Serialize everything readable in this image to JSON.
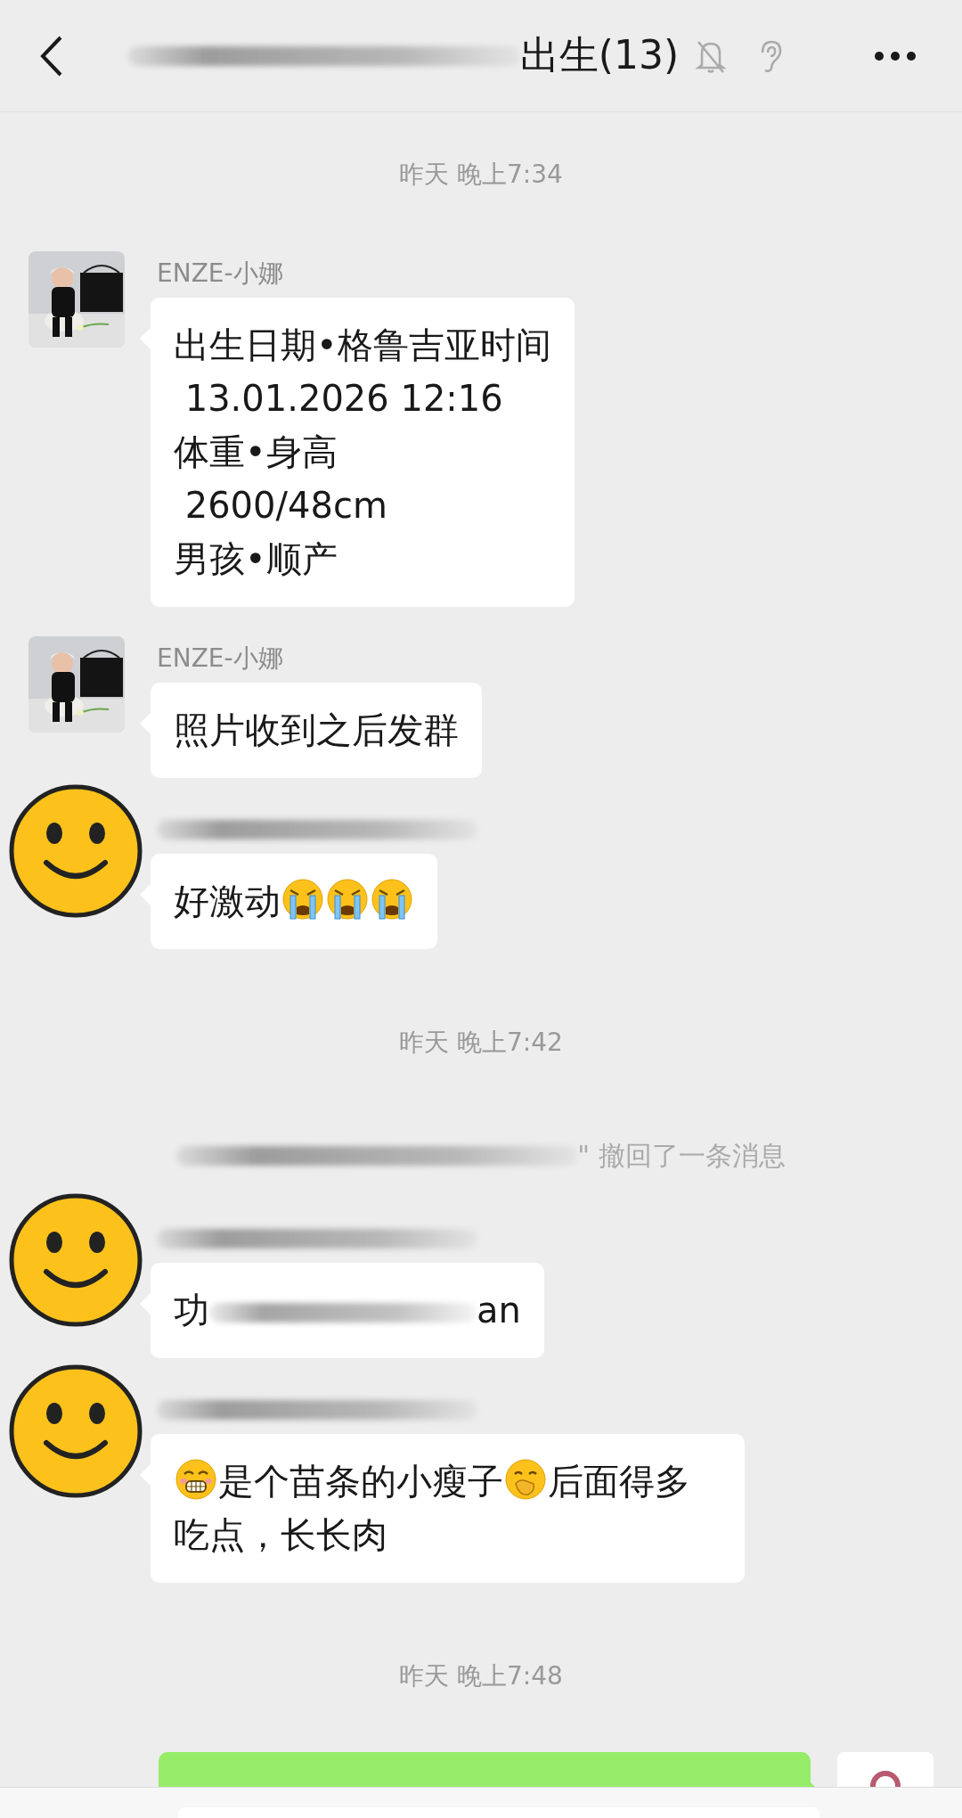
{
  "header": {
    "title_parts": [
      {
        "kind": "redacted"
      },
      {
        "kind": "text",
        "text": "出生(13)"
      }
    ]
  },
  "messages": [
    {
      "kind": "time",
      "text": "昨天 晚上7:34"
    },
    {
      "kind": "incoming",
      "avatar": {
        "kind": "picture"
      },
      "sender": [
        {
          "kind": "text",
          "text": "ENZE-小娜"
        }
      ],
      "content": [
        {
          "kind": "text",
          "text": "出生日期•格鲁吉亚时间\n 13.01.2026 12:16\n体重•身高\n 2600/48cm\n男孩•顺产"
        }
      ]
    },
    {
      "kind": "incoming",
      "avatar": {
        "kind": "picture"
      },
      "sender": [
        {
          "kind": "text",
          "text": "ENZE-小娜"
        }
      ],
      "content": [
        {
          "kind": "text",
          "text": "照片收到之后发群"
        }
      ]
    },
    {
      "kind": "incoming",
      "avatar": {
        "kind": "smiley"
      },
      "sender": [
        {
          "kind": "redacted"
        }
      ],
      "content": [
        {
          "kind": "text",
          "text": "好激动"
        },
        {
          "kind": "crying_emoji"
        },
        {
          "kind": "crying_emoji"
        },
        {
          "kind": "crying_emoji"
        }
      ]
    },
    {
      "kind": "time",
      "text": "昨天 晚上7:42"
    },
    {
      "kind": "recall",
      "parts": [
        {
          "kind": "redacted"
        },
        {
          "kind": "text",
          "text": "\" 撤回了一条消息"
        }
      ]
    },
    {
      "kind": "incoming",
      "avatar": {
        "kind": "smiley"
      },
      "sender": [
        {
          "kind": "redacted"
        }
      ],
      "content": [
        {
          "kind": "text",
          "text": "功"
        },
        {
          "kind": "redacted"
        },
        {
          "kind": "text",
          "text": "an"
        }
      ]
    },
    {
      "kind": "incoming",
      "avatar": {
        "kind": "smiley"
      },
      "sender": [
        {
          "kind": "redacted"
        }
      ],
      "content": [
        {
          "kind": "grin_emoji"
        },
        {
          "kind": "text",
          "text": "是个苗条的小瘦子"
        },
        {
          "kind": "hand_over_mouth_emoji"
        },
        {
          "kind": "text",
          "text": "后面得多吃点，长长肉"
        }
      ]
    },
    {
      "kind": "time",
      "text": "昨天 晚上7:48"
    },
    {
      "kind": "outgoing",
      "avatar": {
        "kind": "logo"
      }
    }
  ]
}
